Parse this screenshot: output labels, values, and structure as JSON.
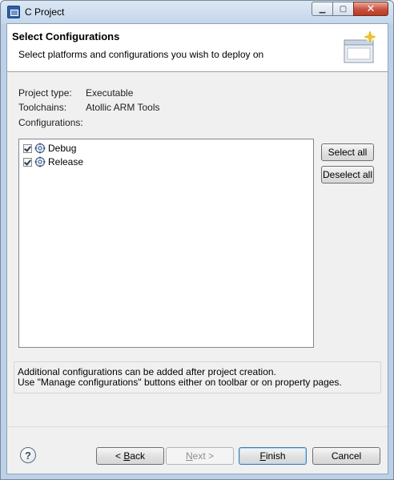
{
  "window": {
    "title": "C Project"
  },
  "header": {
    "title": "Select Configurations",
    "description": "Select platforms and configurations you wish to deploy on"
  },
  "info": {
    "project_type_label": "Project type:",
    "project_type_value": "Executable",
    "toolchains_label": "Toolchains:",
    "toolchains_value": "Atollic ARM Tools",
    "configurations_label": "Configurations:"
  },
  "configurations": [
    {
      "label": "Debug",
      "checked": true
    },
    {
      "label": "Release",
      "checked": true
    }
  ],
  "side_buttons": {
    "select_all": "Select all",
    "deselect_all": "Deselect all"
  },
  "note": {
    "line1": "Additional configurations can be added after project creation.",
    "line2": "Use \"Manage configurations\" buttons either on toolbar or on property pages."
  },
  "footer": {
    "help": "?",
    "back_mnemonic": "B",
    "back_rest": "ack",
    "back_prefix": "< ",
    "next_mnemonic": "N",
    "next_rest": "ext >",
    "finish_mnemonic": "F",
    "finish_rest": "inish",
    "cancel": "Cancel"
  }
}
